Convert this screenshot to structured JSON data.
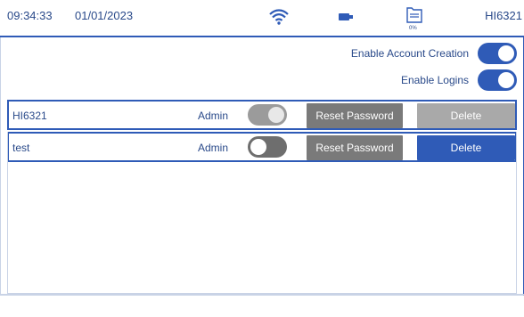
{
  "status_bar": {
    "time": "09:34:33",
    "date": "01/01/2023",
    "battery_percent": "0%",
    "device_name": "HI6321",
    "accent_color": "#2f5bb7"
  },
  "settings": {
    "enable_account_creation": {
      "label": "Enable Account Creation",
      "state": "on"
    },
    "enable_logins": {
      "label": "Enable Logins",
      "state": "on"
    }
  },
  "users": [
    {
      "name": "HI6321",
      "role": "Admin",
      "toggle": "disabled",
      "reset_label": "Reset Password",
      "delete_label": "Delete",
      "delete_state": "disabled"
    },
    {
      "name": "test",
      "role": "Admin",
      "toggle": "off",
      "reset_label": "Reset Password",
      "delete_label": "Delete",
      "delete_state": "active"
    }
  ]
}
